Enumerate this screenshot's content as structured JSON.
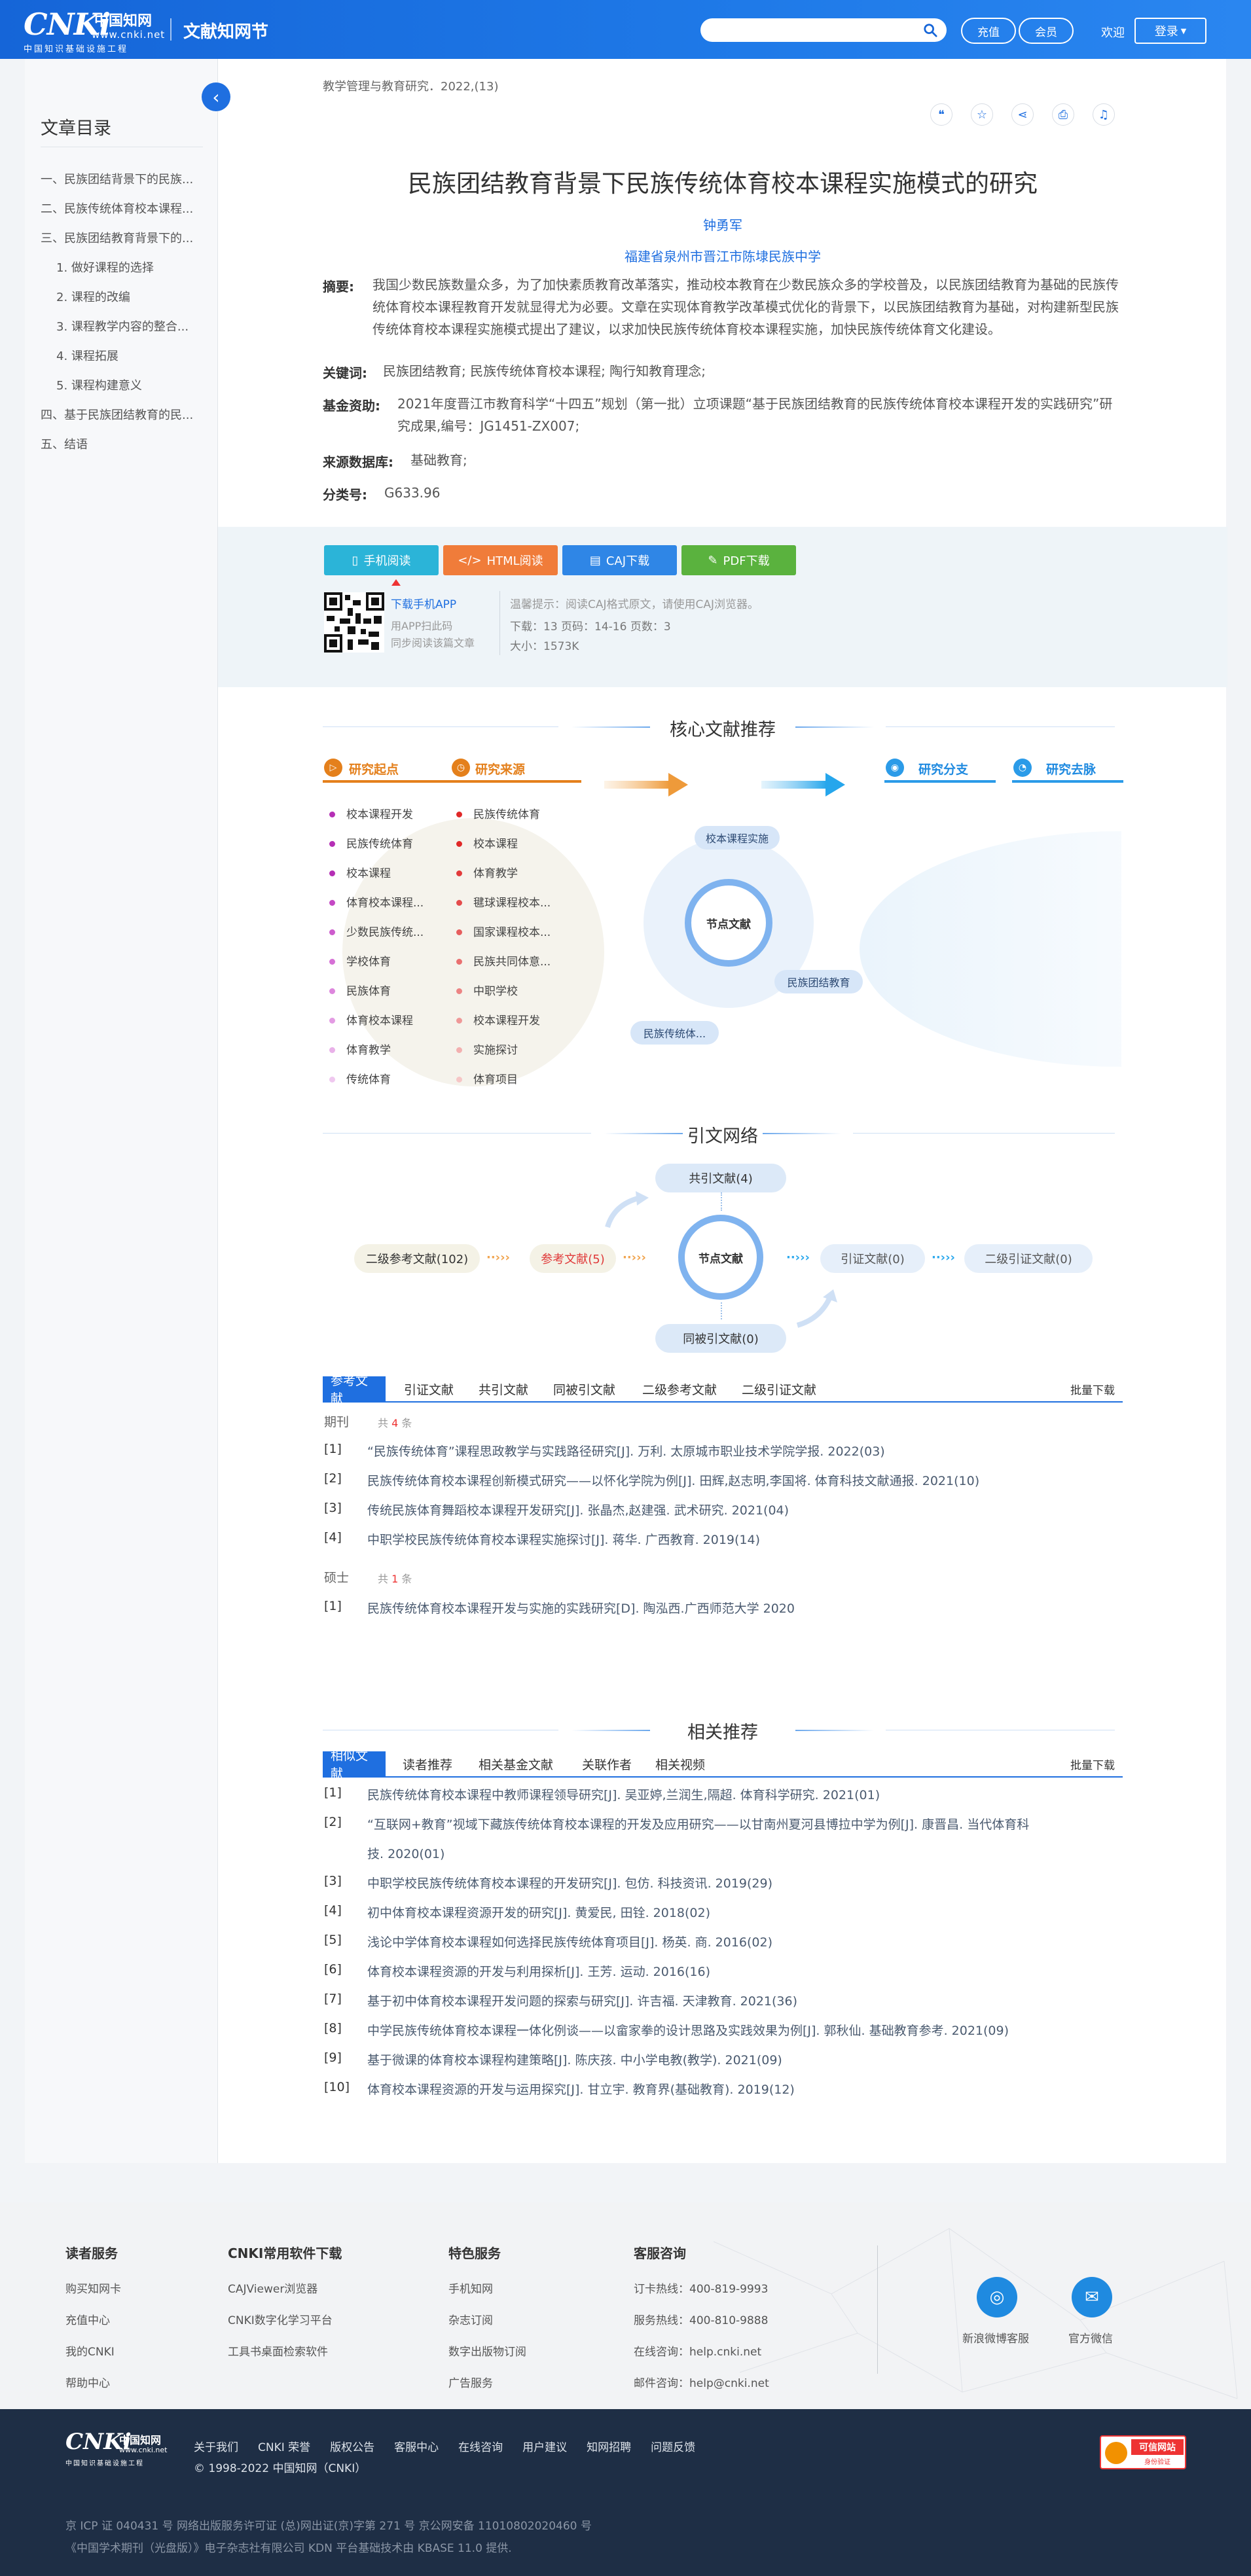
{
  "header": {
    "logo_main": "CNKi",
    "logo_cn": "中国知网",
    "logo_url": "www.cnki.net",
    "logo_sub": "中国知识基础设施工程",
    "site_name": "文献知网节",
    "search_placeholder": "",
    "recharge": "充值",
    "member": "会员",
    "welcome": "欢迎",
    "login": "登录"
  },
  "toc": {
    "title": "文章目录",
    "items": [
      "一、民族团结背景下的民族...",
      "二、民族传统体育校本课程...",
      "三、民族团结教育背景下的...",
      "1. 做好课程的选择",
      "2. 课程的改编",
      "3. 课程教学内容的整合...",
      "4. 课程拓展",
      "5. 课程构建意义",
      "四、基于民族团结教育的民...",
      "五、结语"
    ]
  },
  "article": {
    "journal": "教学管理与教育研究．2022,(13)",
    "title": "民族团结教育背景下民族传统体育校本课程实施模式的研究",
    "author": "钟勇军",
    "org": "福建省泉州市晋江市陈埭民族中学",
    "abstract_label": "摘要:",
    "abstract": "我国少数民族数量众多，为了加快素质教育改革落实，推动校本教育在少数民族众多的学校普及，以民族团结教育为基础的民族传统体育校本课程教育开发就显得尤为必要。文章在实现体育教学改革模式优化的背景下，以民族团结教育为基础，对构建新型民族传统体育校本课程实施模式提出了建议，以求加快民族传统体育校本课程实施，加快民族传统体育文化建设。",
    "keywords_label": "关键词:",
    "keywords": "民族团结教育;  民族传统体育校本课程;  陶行知教育理念;",
    "fund_label": "基金资助:",
    "fund": "2021年度晋江市教育科学“十四五”规划（第一批）立项课题“基于民族团结教育的民族传统体育校本课程开发的实践研究”研究成果,编号：JG1451-ZX007;",
    "source_label": "来源数据库:",
    "source": "基础教育;",
    "class_label": "分类号:",
    "class": "G633.96"
  },
  "download": {
    "mobile": "手机阅读",
    "html": "HTML阅读",
    "caj": "CAJ下载",
    "pdf": "PDF下载",
    "app_link": "下载手机APP",
    "app_tip1": "用APP扫此码",
    "app_tip2": "同步阅读该篇文章",
    "tip": "温馨提示：阅读CAJ格式原文，请使用CAJ浏览器。",
    "meta": "下载：13    页码：14-16    页数：3",
    "size": "大小：1573K"
  },
  "core": {
    "heading": "核心文献推荐",
    "origin_head": "研究起点",
    "source_head": "研究来源",
    "branch_head": "研究分支",
    "trend_head": "研究去脉",
    "origin_items": [
      "校本课程开发",
      "民族传统体育",
      "校本课程",
      "体育校本课程...",
      "少数民族传统...",
      "学校体育",
      "民族体育",
      "体育校本课程",
      "体育教学",
      "传统体育"
    ],
    "source_items": [
      "民族传统体育",
      "校本课程",
      "体育教学",
      "毽球课程校本...",
      "国家课程校本...",
      "民族共同体意...",
      "中职学校",
      "校本课程开发",
      "实施探讨",
      "体育项目"
    ],
    "node": "节点文献",
    "tag1": "校本课程实施",
    "tag2": "民族团结教育",
    "tag3": "民族传统体..."
  },
  "network": {
    "heading": "引文网络",
    "cocited": "共引文献(4)",
    "second_refs": "二级参考文献(102)",
    "refs": "参考文献(5)",
    "node": "节点文献",
    "cites": "引证文献(0)",
    "second_cites": "二级引证文献(0)",
    "cocited_by": "同被引文献(0)"
  },
  "reftabs": {
    "tabs": [
      "参考文献",
      "引证文献",
      "共引文献",
      "同被引文献",
      "二级参考文献",
      "二级引证文献"
    ],
    "batch": "批量下载",
    "group1_label": "期刊",
    "group1_count_pre": "共",
    "group1_count": "4",
    "group1_count_post": "条",
    "group1": [
      {
        "num": "[1]",
        "text": "“民族传统体育”课程思政教学与实践路径研究[J]. 万利.  太原城市职业技术学院学报. 2022(03)"
      },
      {
        "num": "[2]",
        "text": "民族传统体育校本课程创新模式研究——以怀化学院为例[J]. 田辉,赵志明,李国将.  体育科技文献通报. 2021(10)"
      },
      {
        "num": "[3]",
        "text": "传统民族体育舞蹈校本课程开发研究[J]. 张晶杰,赵建强.  武术研究. 2021(04)"
      },
      {
        "num": "[4]",
        "text": "中职学校民族传统体育校本课程实施探讨[J]. 蒋华.  广西教育. 2019(14)"
      }
    ],
    "group2_label": "硕士",
    "group2_count_pre": "共",
    "group2_count": "1",
    "group2_count_post": "条",
    "group2": [
      {
        "num": "[1]",
        "text": "民族传统体育校本课程开发与实施的实践研究[D]. 陶泓西.广西师范大学 2020"
      }
    ]
  },
  "related": {
    "heading": "相关推荐",
    "tabs": [
      "相似文献",
      "读者推荐",
      "相关基金文献",
      "关联作者",
      "相关视频"
    ],
    "batch": "批量下载",
    "items": [
      {
        "num": "[1]",
        "text": "民族传统体育校本课程中教师课程领导研究[J]. 吴亚婷,兰润生,隔超.  体育科学研究. 2021(01)"
      },
      {
        "num": "[2]",
        "text": "“互联网+教育”视域下藏族传统体育校本课程的开发及应用研究——以甘南州夏河县博拉中学为例[J]. 康晋昌.  当代体育科"
      },
      {
        "num": "",
        "text": "技. 2020(01)"
      },
      {
        "num": "[3]",
        "text": "中职学校民族传统体育校本课程的开发研究[J]. 包仿.  科技资讯. 2019(29)"
      },
      {
        "num": "[4]",
        "text": "初中体育校本课程资源开发的研究[J]. 黄爱民,  田铨. 2018(02)"
      },
      {
        "num": "[5]",
        "text": "浅论中学体育校本课程如何选择民族传统体育项目[J]. 杨英.  商. 2016(02)"
      },
      {
        "num": "[6]",
        "text": "体育校本课程资源的开发与利用探析[J]. 王芳.  运动. 2016(16)"
      },
      {
        "num": "[7]",
        "text": "基于初中体育校本课程开发问题的探索与研究[J]. 许吉福.  天津教育. 2021(36)"
      },
      {
        "num": "[8]",
        "text": "中学民族传统体育校本课程一体化例谈——以畲家拳的设计思路及实践效果为例[J]. 郭秋仙.  基础教育参考. 2021(09)"
      },
      {
        "num": "[9]",
        "text": "基于微课的体育校本课程构建策略[J]. 陈庆孩.  中小学电教(教学). 2021(09)"
      },
      {
        "num": "[10]",
        "text": "体育校本课程资源的开发与运用探究[J]. 甘立宇.  教育界(基础教育). 2019(12)"
      }
    ]
  },
  "footer": {
    "col1_head": "读者服务",
    "col1": [
      "购买知网卡",
      "充值中心",
      "我的CNKI",
      "帮助中心"
    ],
    "col2_head": "CNKI常用软件下载",
    "col2": [
      "CAJViewer浏览器",
      "CNKI数字化学习平台",
      "工具书桌面检索软件"
    ],
    "col3_head": "特色服务",
    "col3": [
      "手机知网",
      "杂志订阅",
      "数字出版物订阅",
      "广告服务"
    ],
    "col4_head": "客服咨询",
    "col4": [
      "订卡热线：400-819-9993",
      "服务热线：400-810-9888",
      "在线咨询：help.cnki.net",
      "邮件咨询：help@cnki.net"
    ],
    "weibo": "新浪微博客服",
    "wechat": "官方微信",
    "links": [
      "关于我们",
      "CNKI 荣誉",
      "版权公告",
      "客服中心",
      "在线咨询",
      "用户建议",
      "知网招聘",
      "问题反馈"
    ],
    "copyright": "© 1998-2022 中国知网（CNKI）",
    "trust_badge": "可信网站",
    "trust_sub": "身份验证",
    "icp": "京 ICP 证 040431 号 网络出版服务许可证 (总)网出证(京)字第 271 号 京公网安备 11010802020460 号",
    "edition": "《中国学术期刊（光盘版）》电子杂志社有限公司 KDN 平台基础技术由 KBASE 11.0 提供."
  },
  "colors": {
    "brand": "#1f6fe0",
    "mobile_btn": "#2bb4d8",
    "html_btn": "#f07c3a",
    "caj_btn": "#2f86e6",
    "pdf_btn": "#5ab23e",
    "origin": "#e4801c"
  }
}
